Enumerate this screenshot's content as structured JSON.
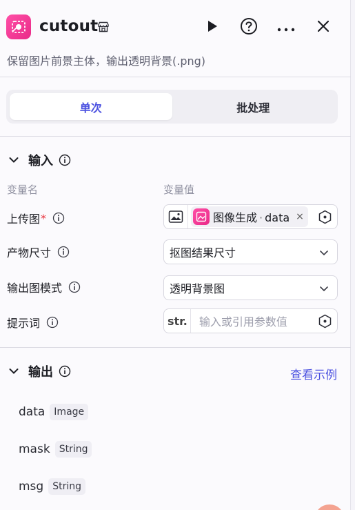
{
  "header": {
    "title": "cutout",
    "subtitle": "保留图片前景主体，输出透明背景(.png)"
  },
  "tabs": [
    {
      "label": "单次",
      "active": true
    },
    {
      "label": "批处理",
      "active": false
    }
  ],
  "input_section": {
    "title": "输入",
    "col_name": "变量名",
    "col_value": "变量值",
    "rows": {
      "upload": {
        "label": "上传图",
        "required_mark": "*",
        "chip_text": "图像生成",
        "chip_sep": "·",
        "chip_var": "data",
        "chip_close": "×"
      },
      "size": {
        "label": "产物尺寸",
        "value": "抠图结果尺寸"
      },
      "mode": {
        "label": "输出图模式",
        "value": "透明背景图"
      },
      "prompt": {
        "label": "提示词",
        "badge": "str.",
        "placeholder": "输入或引用参数值"
      }
    }
  },
  "output_section": {
    "title": "输出",
    "example_link": "查看示例",
    "outputs": [
      {
        "name": "data",
        "type": "Image"
      },
      {
        "name": "mask",
        "type": "String"
      },
      {
        "name": "msg",
        "type": "String"
      }
    ]
  },
  "colors": {
    "accent": "#4b51e0",
    "brand_pink": "#e92a88",
    "required": "#e8313a"
  },
  "icons": [
    "cutout-app-icon",
    "store-icon",
    "play-icon",
    "help-icon",
    "more-icon",
    "close-icon",
    "chevron-down-icon",
    "info-icon",
    "image-upload-icon",
    "reference-icon"
  ]
}
